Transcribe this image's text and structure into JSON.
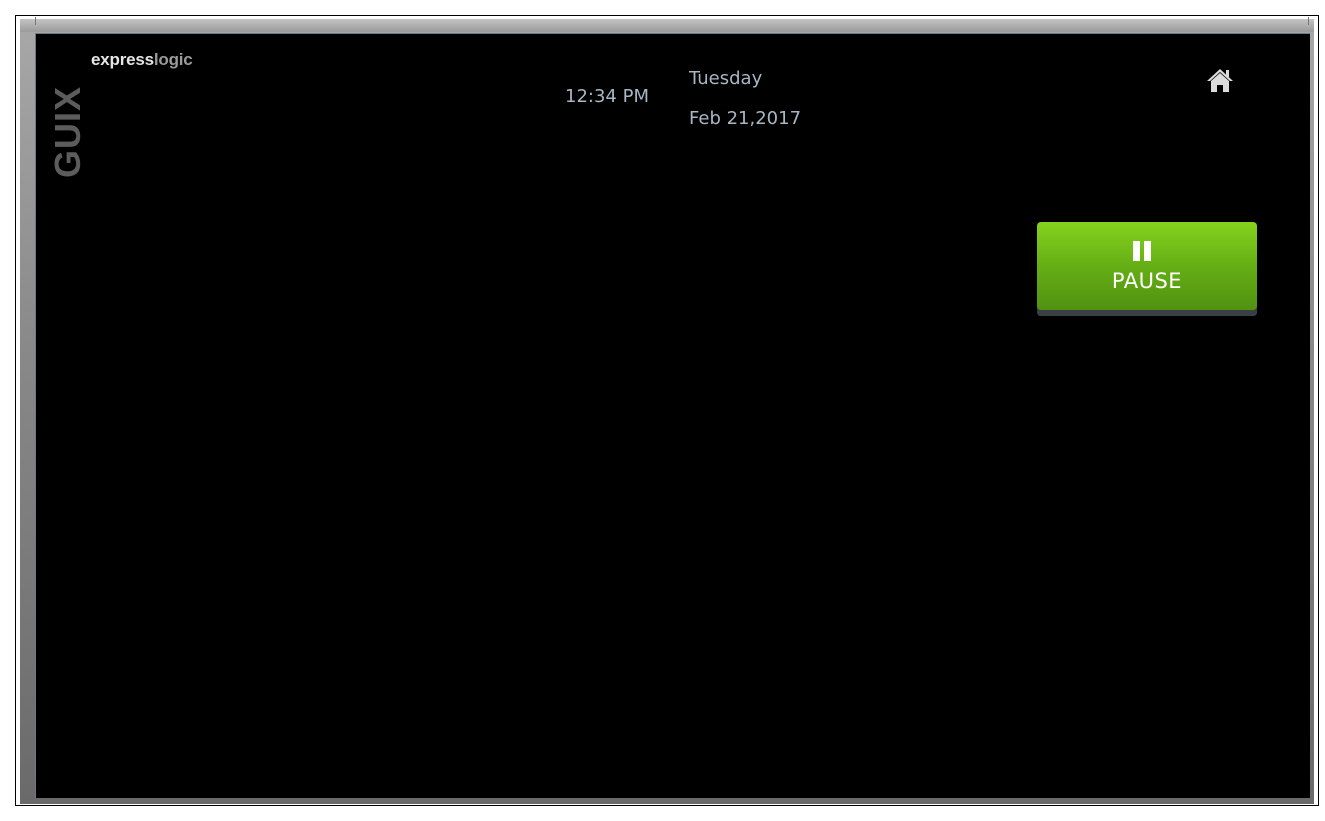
{
  "brand": {
    "bold_part": "express",
    "light_part": "logic",
    "vertical_logo": "GUIX"
  },
  "clock": {
    "time": "12:34 PM",
    "weekday": "Tuesday",
    "date": "Feb 21,2017"
  },
  "controls": {
    "home_icon": "home-icon",
    "pause_icon": "pause-icon",
    "pause_label": "PAUSE"
  },
  "colors": {
    "screen_background": "#000000",
    "clock_text": "#a8b6c6",
    "pause_button_green": "#66b015",
    "icon_color": "#dcdcdc"
  }
}
